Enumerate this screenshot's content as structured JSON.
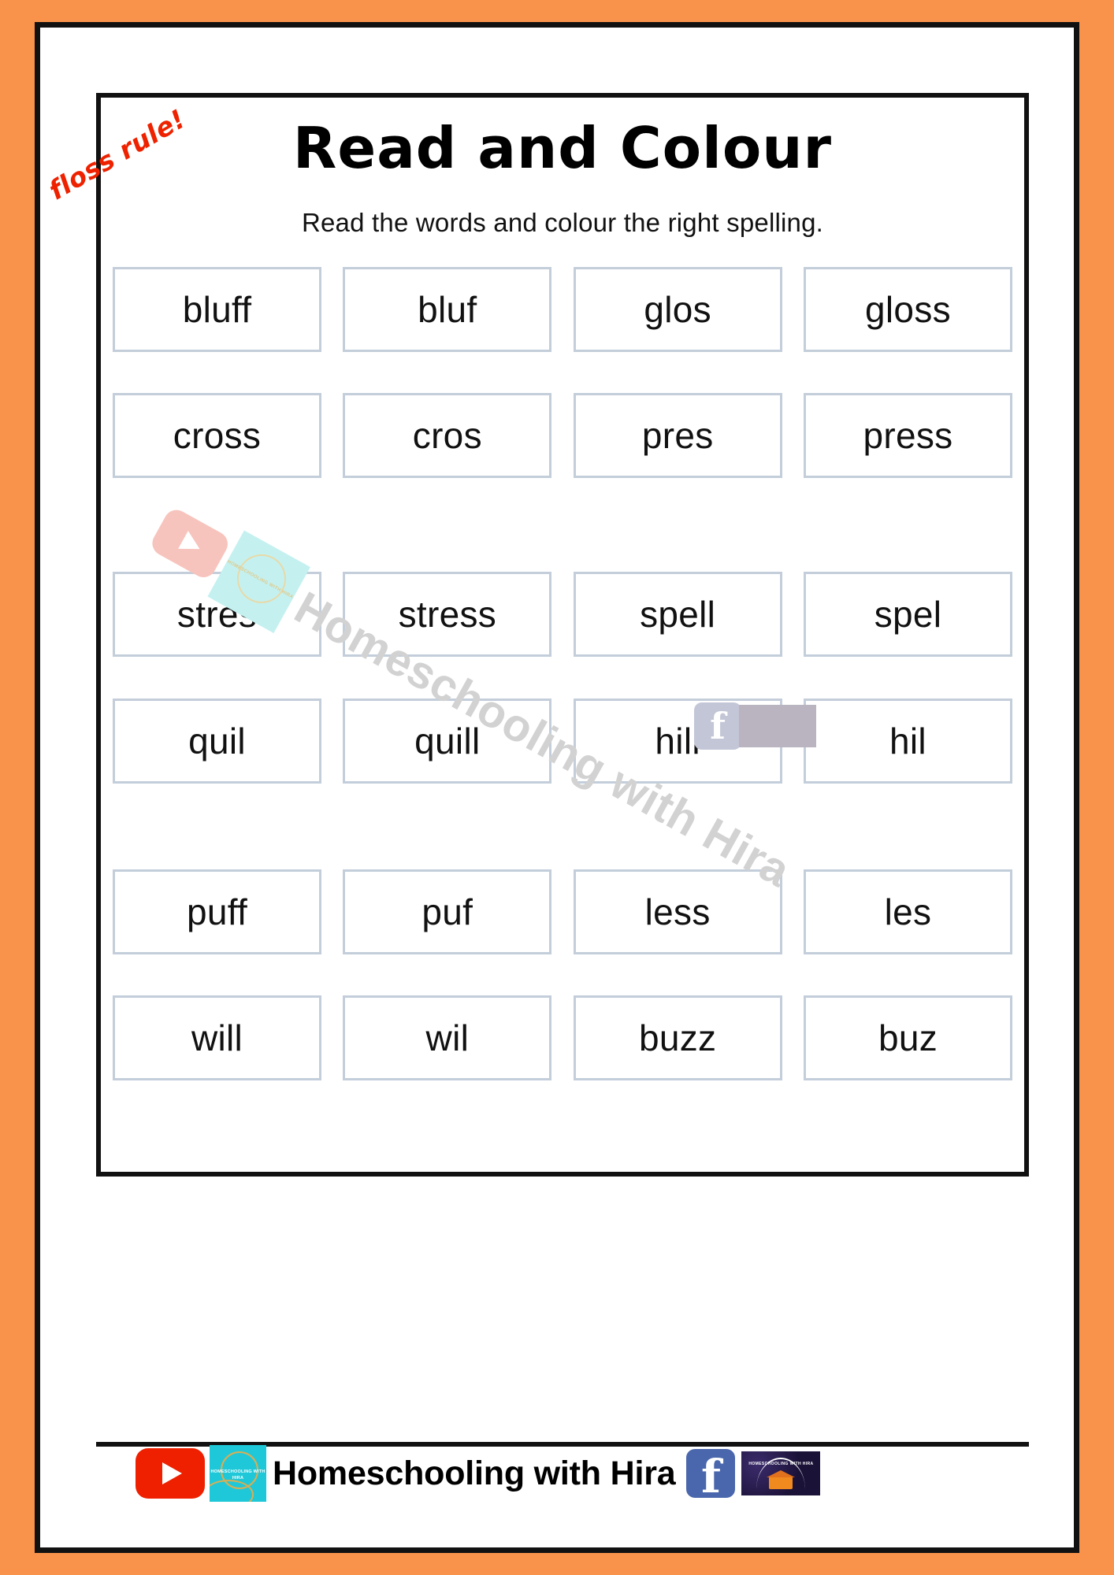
{
  "page": {
    "background_color": "#F9924B",
    "sheet_color": "#FFFFFF",
    "border_color": "#111111"
  },
  "header": {
    "title": "Read and Colour",
    "subtitle": "Read the words and colour the right spelling.",
    "sticker_label": "floss rule!",
    "sticker_color": "#EE2200"
  },
  "worksheet": {
    "box_border_color": "#C3CEDA",
    "rows": [
      {
        "cells": [
          {
            "word": "bluff"
          },
          {
            "word": "bluf"
          },
          {
            "word": "glos"
          },
          {
            "word": "gloss"
          }
        ]
      },
      {
        "cells": [
          {
            "word": "cross"
          },
          {
            "word": "cros"
          },
          {
            "word": "pres"
          },
          {
            "word": "press"
          }
        ]
      },
      {
        "cells": [
          {
            "word": "stres"
          },
          {
            "word": "stress"
          },
          {
            "word": "spell"
          },
          {
            "word": "spel"
          }
        ]
      },
      {
        "cells": [
          {
            "word": "quil"
          },
          {
            "word": "quill"
          },
          {
            "word": "hill"
          },
          {
            "word": "hil"
          }
        ]
      },
      {
        "cells": [
          {
            "word": "puff"
          },
          {
            "word": "puf"
          },
          {
            "word": "less"
          },
          {
            "word": "les"
          }
        ]
      },
      {
        "cells": [
          {
            "word": "will"
          },
          {
            "word": "wil"
          },
          {
            "word": "buzz"
          },
          {
            "word": "buz"
          }
        ]
      }
    ]
  },
  "watermark": {
    "text": "Homeschooling with Hira",
    "logo_caption": "HOMESCHOOLING WITH HIRA",
    "facebook_glyph": "f",
    "color": "#D2D2D2"
  },
  "footer": {
    "brand": "Homeschooling with Hira",
    "logo_caption": "HOMESCHOOLING WITH HIRA",
    "facebook_glyph": "f",
    "banner_caption": "HOMESCHOOLING WITH HIRA",
    "youtube_color": "#EE2000",
    "logo_color": "#1FC8D8",
    "facebook_color": "#4A67AD"
  }
}
